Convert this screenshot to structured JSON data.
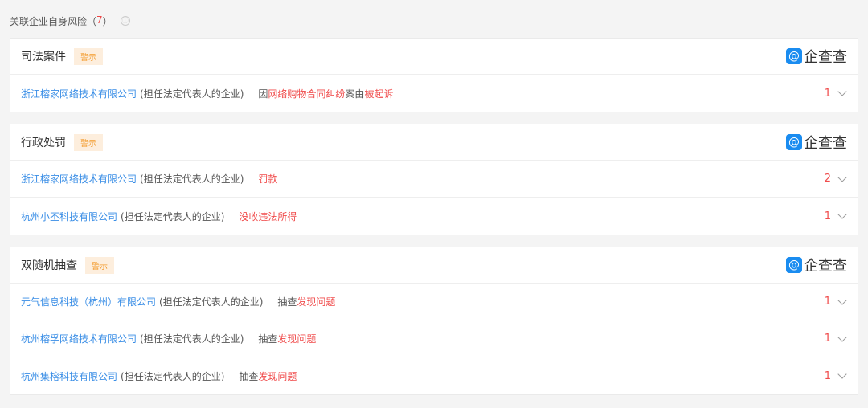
{
  "header": {
    "title": "关联企业自身风险",
    "count_open": "（",
    "count": "7",
    "count_close": "）",
    "info_icon": "ⓘ"
  },
  "logo": {
    "mark": "@",
    "text": "企查查"
  },
  "sections": [
    {
      "title": "司法案件",
      "tag": "警示",
      "rows": [
        {
          "company": "浙江榕家网络技术有限公司",
          "role": "(担任法定代表人的企业)",
          "desc": [
            {
              "t": "因",
              "hl": false
            },
            {
              "t": "网络购物合同纠纷",
              "hl": true
            },
            {
              "t": "案由",
              "hl": false
            },
            {
              "t": "被起诉",
              "hl": true
            }
          ],
          "count": "1"
        }
      ]
    },
    {
      "title": "行政处罚",
      "tag": "警示",
      "rows": [
        {
          "company": "浙江榕家网络技术有限公司",
          "role": "(担任法定代表人的企业)",
          "desc": [
            {
              "t": "罚款",
              "hl": true
            }
          ],
          "count": "2"
        },
        {
          "company": "杭州小丕科技有限公司",
          "role": "(担任法定代表人的企业)",
          "desc": [
            {
              "t": "没收违法所得",
              "hl": true
            }
          ],
          "count": "1"
        }
      ]
    },
    {
      "title": "双随机抽查",
      "tag": "警示",
      "rows": [
        {
          "company": "元气信息科技（杭州）有限公司",
          "role": "(担任法定代表人的企业)",
          "desc": [
            {
              "t": "抽查",
              "hl": false
            },
            {
              "t": "发现问题",
              "hl": true
            }
          ],
          "count": "1"
        },
        {
          "company": "杭州榕孚网络技术有限公司",
          "role": "(担任法定代表人的企业)",
          "desc": [
            {
              "t": "抽查",
              "hl": false
            },
            {
              "t": "发现问题",
              "hl": true
            }
          ],
          "count": "1"
        },
        {
          "company": "杭州集榕科技有限公司",
          "role": "(担任法定代表人的企业)",
          "desc": [
            {
              "t": "抽查",
              "hl": false
            },
            {
              "t": "发现问题",
              "hl": true
            }
          ],
          "count": "1"
        }
      ]
    }
  ]
}
